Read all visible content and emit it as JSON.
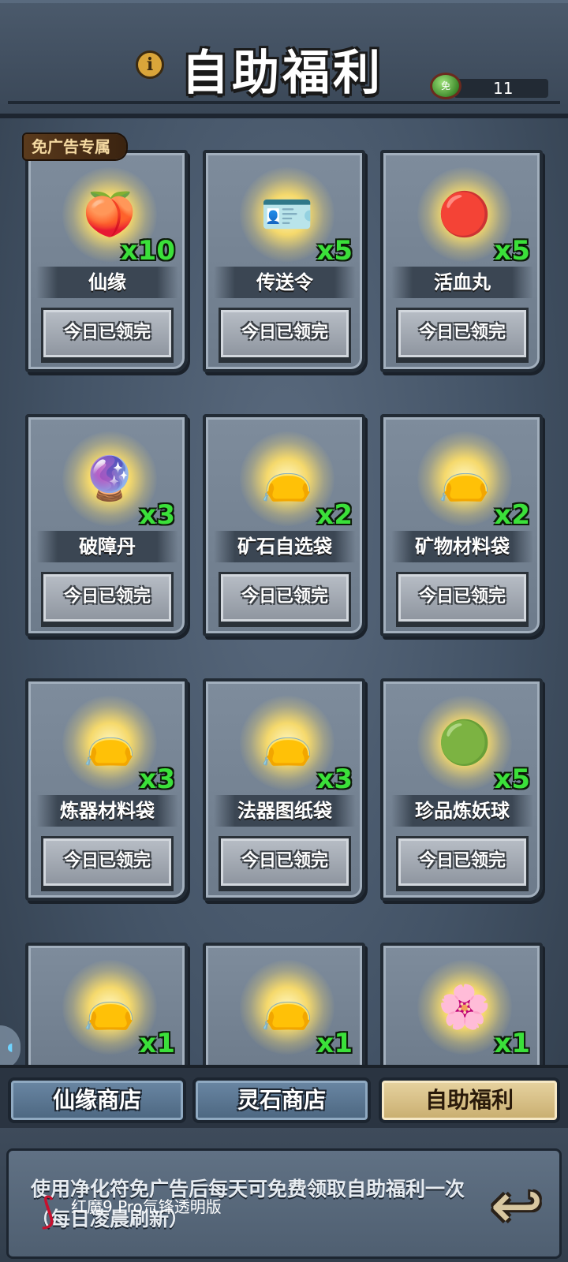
{
  "header": {
    "title": "自助福利",
    "info_icon": "i",
    "currency": {
      "icon": "免",
      "amount": "11"
    }
  },
  "badge": "免广告专属",
  "cards": [
    {
      "icon": "🍑",
      "qty": "x10",
      "name": "仙缘",
      "button": "今日已领完"
    },
    {
      "icon": "🪪",
      "qty": "x5",
      "name": "传送令",
      "button": "今日已领完"
    },
    {
      "icon": "🔴",
      "qty": "x5",
      "name": "活血丸",
      "button": "今日已领完"
    },
    {
      "icon": "🔮",
      "qty": "x3",
      "name": "破障丹",
      "button": "今日已领完"
    },
    {
      "icon": "👝",
      "qty": "x2",
      "name": "矿石自选袋",
      "button": "今日已领完"
    },
    {
      "icon": "👝",
      "qty": "x2",
      "name": "矿物材料袋",
      "button": "今日已领完"
    },
    {
      "icon": "👝",
      "qty": "x3",
      "name": "炼器材料袋",
      "button": "今日已领完"
    },
    {
      "icon": "👝",
      "qty": "x3",
      "name": "法器图纸袋",
      "button": "今日已领完"
    },
    {
      "icon": "🟢",
      "qty": "x5",
      "name": "珍品炼妖球",
      "button": "今日已领完"
    },
    {
      "icon": "👝",
      "qty": "x1"
    },
    {
      "icon": "👝",
      "qty": "x1"
    },
    {
      "icon": "🌸",
      "qty": "x1"
    }
  ],
  "tabs": [
    {
      "label": "仙缘商店"
    },
    {
      "label": "灵石商店"
    },
    {
      "label": "自助福利",
      "active": true
    }
  ],
  "footer": {
    "description": "使用净化符免广告后每天可免费领取自助福利一次（每日凌晨刷新）",
    "back_icon": "↩"
  },
  "watermark": "红魔9 Pro氘锋透明版",
  "colors": {
    "quantity": "#3be03a",
    "active_tab": "#e7d3a1",
    "tab": "#5a7692"
  }
}
